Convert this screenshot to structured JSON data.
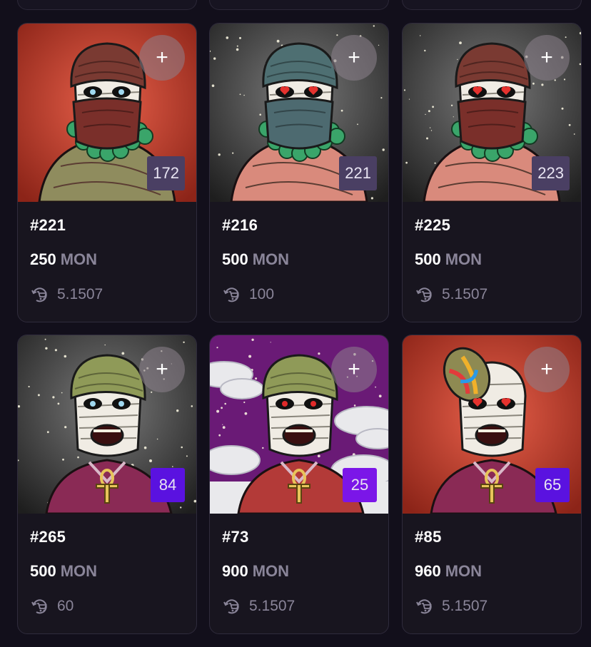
{
  "cards": [
    {
      "id": "#221",
      "price": "250",
      "currency": "MON",
      "royalty": "5.1507",
      "rank": "172",
      "rank_color": "#4a3f63",
      "bg": "red",
      "wrap": "#7a3a32",
      "mask": "#7a2f2a",
      "eyes": "blue",
      "beads": true,
      "cloth": "#8f8c5e",
      "shirt": "none"
    },
    {
      "id": "#216",
      "price": "500",
      "currency": "MON",
      "royalty": "100",
      "rank": "221",
      "rank_color": "#4a3f63",
      "bg": "stars",
      "wrap": "#4e6f72",
      "mask": "#4d6a70",
      "eyes": "hearts",
      "beads": true,
      "cloth": "#d98a7c",
      "shirt": "none"
    },
    {
      "id": "#225",
      "price": "500",
      "currency": "MON",
      "royalty": "5.1507",
      "rank": "223",
      "rank_color": "#4a3f63",
      "bg": "stars",
      "wrap": "#7a3a32",
      "mask": "#7a2f2a",
      "eyes": "hearts",
      "beads": true,
      "cloth": "#d98a7c",
      "shirt": "none"
    },
    {
      "id": "#265",
      "price": "500",
      "currency": "MON",
      "royalty": "60",
      "rank": "84",
      "rank_color": "#5a12e0",
      "bg": "stars",
      "wrap": "#8f9a58",
      "mask": "none",
      "eyes": "blue",
      "beads": false,
      "cloth": "#8a2a55",
      "shirt": "ankh"
    },
    {
      "id": "#73",
      "price": "900",
      "currency": "MON",
      "royalty": "5.1507",
      "rank": "25",
      "rank_color": "#7b16e8",
      "bg": "purple",
      "wrap": "#8f9a58",
      "mask": "none",
      "eyes": "red",
      "beads": false,
      "cloth": "#b33a38",
      "shirt": "ankh"
    },
    {
      "id": "#85",
      "price": "960",
      "currency": "MON",
      "royalty": "5.1507",
      "rank": "65",
      "rank_color": "#5a12e0",
      "bg": "red",
      "wrap": "none",
      "mask": "none",
      "eyes": "hearts",
      "beads": false,
      "cloth": "#8a2a55",
      "shirt": "ankh"
    }
  ],
  "icons": {
    "add": "plus-icon",
    "royalty": "cart-rotate-icon"
  }
}
